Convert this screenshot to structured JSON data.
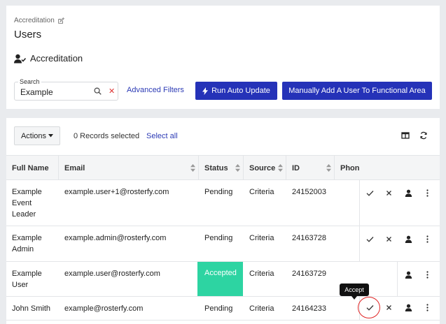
{
  "header": {
    "breadcrumb": "Accreditation",
    "page_title": "Users",
    "section_title": "Accreditation"
  },
  "search": {
    "label": "Search",
    "value": "Example"
  },
  "toolbar": {
    "advanced_filters": "Advanced Filters",
    "run_auto_update": "Run Auto Update",
    "manual_add": "Manually Add A User To Functional Area"
  },
  "table_toolbar": {
    "actions_label": "Actions",
    "records_selected": "0 Records selected",
    "select_all": "Select all"
  },
  "table": {
    "columns": [
      "Full Name",
      "Email",
      "Status",
      "Source",
      "ID",
      "Phon"
    ],
    "rows": [
      {
        "name_lines": [
          "Example",
          "Event",
          "Leader"
        ],
        "email": "example.user+1@rosterfy.com",
        "status": "Pending",
        "source": "Criteria",
        "id": "24152003"
      },
      {
        "name_lines": [
          "Example",
          "Admin",
          ""
        ],
        "email": "example.admin@rosterfy.com",
        "status": "Pending",
        "source": "Criteria",
        "id": "24163728"
      },
      {
        "name_lines": [
          "Example",
          "User",
          ""
        ],
        "email": "example.user@rosterfy.com",
        "status": "Accepted",
        "source": "Criteria",
        "id": "24163729"
      },
      {
        "name_lines": [
          "John Smith",
          "",
          ""
        ],
        "email": "example@rosterfy.com",
        "status": "Pending",
        "source": "Criteria",
        "id": "24164233"
      }
    ]
  },
  "tooltip": {
    "text": "Accept"
  },
  "colors": {
    "primary": "#2532b8",
    "link": "#2c3bb5",
    "accepted": "#2dd4a2",
    "clear": "#dd3333",
    "highlight": "#e02525"
  },
  "icons": {
    "edit": "pencil-square-icon",
    "user_check": "user-check-icon",
    "search": "magnifier-icon",
    "clear": "close-icon",
    "bolt": "lightning-icon",
    "columns": "columns-icon",
    "refresh": "refresh-icon",
    "accept": "check-icon",
    "reject": "close-icon",
    "profile": "user-icon",
    "more": "ellipsis-vertical-icon"
  }
}
